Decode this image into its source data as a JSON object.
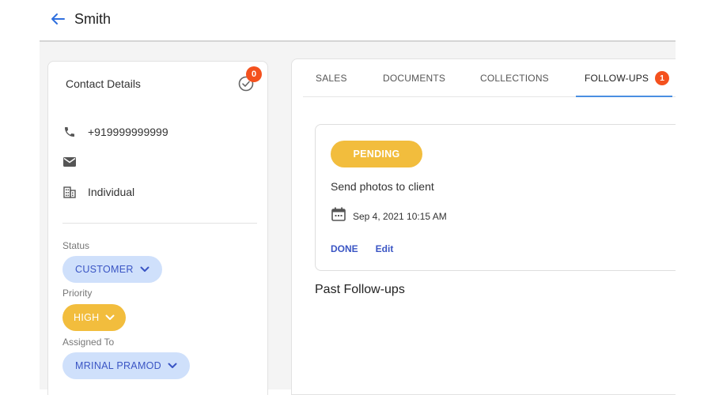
{
  "header": {
    "back_icon": "arrow-left-icon",
    "title": "Smith"
  },
  "contact": {
    "title": "Contact Details",
    "check_badge": "0",
    "phone": "+919999999999",
    "email": "",
    "type": "Individual",
    "status_label": "Status",
    "status_value": "CUSTOMER",
    "priority_label": "Priority",
    "priority_value": "HIGH",
    "assigned_label": "Assigned To",
    "assigned_value": "MRINAL PRAMOD"
  },
  "tabs": [
    {
      "label": "SALES"
    },
    {
      "label": "DOCUMENTS"
    },
    {
      "label": "COLLECTIONS"
    },
    {
      "label": "FOLLOW-UPS",
      "badge": "1",
      "active": true
    }
  ],
  "followup": {
    "status": "PENDING",
    "description": "Send photos to client",
    "datetime": "Sep 4, 2021  10:15 AM",
    "done_label": "DONE",
    "edit_label": "Edit"
  },
  "past_heading": "Past Follow-ups",
  "colors": {
    "accent_blue": "#3a55c4",
    "chip_blue": "#cfe0fb",
    "yellow": "#f2bd3d",
    "badge_red": "#f4511e",
    "tab_indicator": "#4a8fe2"
  }
}
